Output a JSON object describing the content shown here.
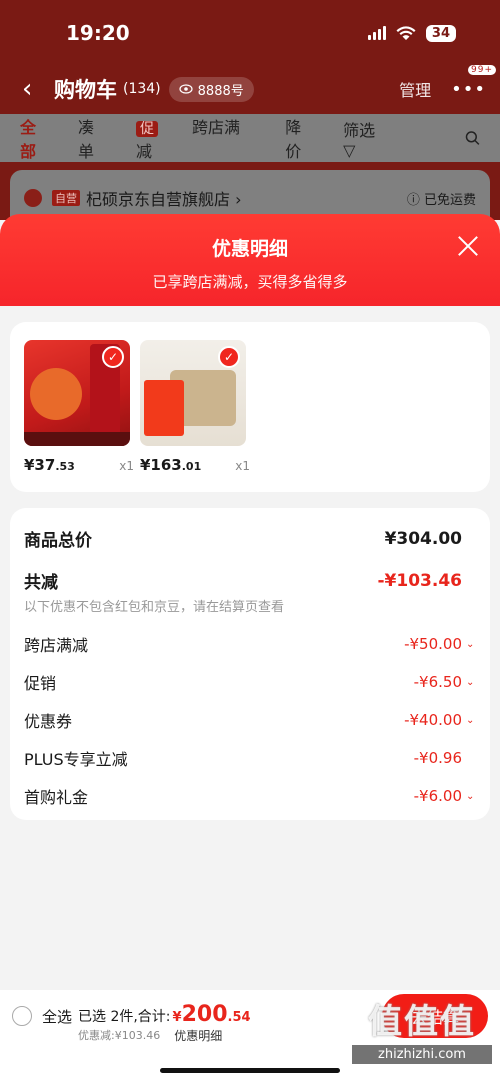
{
  "status_bar": {
    "time": "19:20",
    "battery": "34"
  },
  "header": {
    "back": "‹",
    "title": "购物车",
    "count": "(134)",
    "account": "8888号",
    "manage": "管理",
    "more": "•••",
    "badge": "99+"
  },
  "filters": {
    "all": "全部",
    "combine": "凑单",
    "promo_tag": "促",
    "cross_store": "跨店满减",
    "price_drop": "降价",
    "filter": "筛选",
    "filter_icon": "▽"
  },
  "store": {
    "self_tag": "自营",
    "name": "杞硕京东自营旗舰店 ›",
    "shipping": "ⓘ 已免运费"
  },
  "sheet": {
    "title": "优惠明细",
    "subtitle": "已享跨店满减，买得多省得多"
  },
  "goods": [
    {
      "price_int": "¥37",
      "price_dec": ".53",
      "qty": "x1"
    },
    {
      "price_int": "¥163",
      "price_dec": ".01",
      "qty": "x1"
    }
  ],
  "details": {
    "total_label": "商品总价",
    "total_value": "¥304.00",
    "reduce_label": "共减",
    "reduce_value": "-¥103.46",
    "note": "以下优惠不包含红包和京豆，请在结算页查看",
    "items": [
      {
        "label": "跨店满减",
        "value": "-¥50.00"
      },
      {
        "label": "促销",
        "value": "-¥6.50"
      },
      {
        "label": "优惠券",
        "value": "-¥40.00"
      },
      {
        "label": "PLUS专享立减",
        "value": "-¥0.96"
      },
      {
        "label": "首购礼金",
        "value": "-¥6.00"
      }
    ]
  },
  "bottom": {
    "select_all": "全选",
    "selected": "已选 2件,合计:",
    "total_symbol": "¥",
    "total_int": "200",
    "total_dec": ".54",
    "discount": "优惠减:¥103.46",
    "detail_link": "优惠明细",
    "checkout": "去结算"
  },
  "watermark": {
    "logo": "值值值",
    "url": "zhizhizhi.com"
  },
  "colors": {
    "accent": "#f0271f",
    "header_dim": "#7a1a14"
  }
}
